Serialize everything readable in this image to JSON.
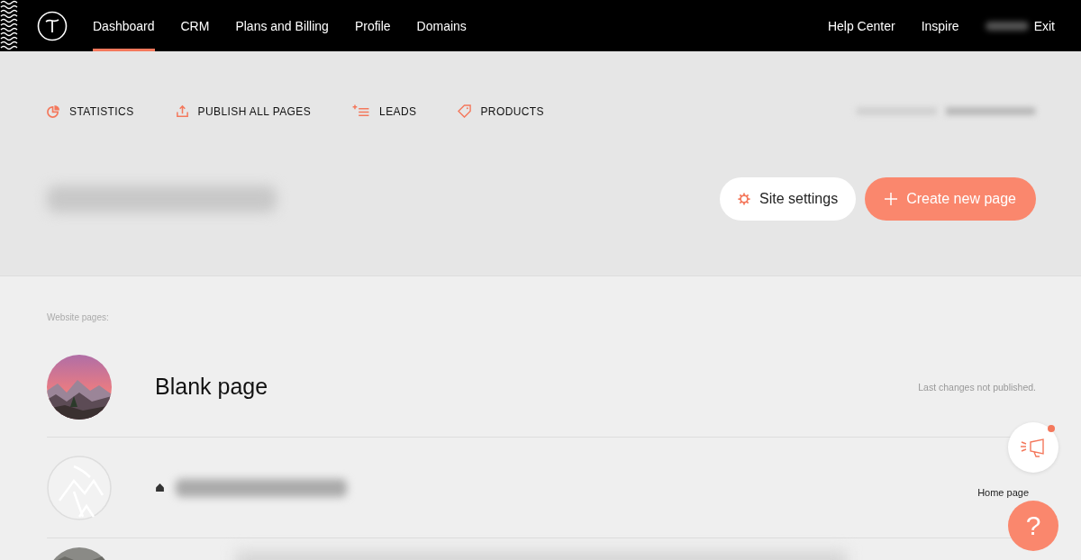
{
  "nav": {
    "items": [
      {
        "label": "Dashboard",
        "selected": true
      },
      {
        "label": "CRM",
        "selected": false
      },
      {
        "label": "Plans and Billing",
        "selected": false
      },
      {
        "label": "Profile",
        "selected": false
      },
      {
        "label": "Domains",
        "selected": false
      }
    ],
    "right": [
      "Help Center",
      "Inspire"
    ],
    "exit": "Exit"
  },
  "toolbar": {
    "actions": [
      {
        "label": "STATISTICS",
        "kind": "statistics"
      },
      {
        "label": "PUBLISH ALL PAGES",
        "kind": "publish"
      },
      {
        "label": "LEADS",
        "kind": "leads"
      },
      {
        "label": "PRODUCTS",
        "kind": "products"
      }
    ]
  },
  "site": {
    "settings_button": "Site settings",
    "create_button": "Create new page"
  },
  "pages": {
    "heading": "Website pages:",
    "rows": [
      {
        "title": "Blank page",
        "status": "Last changes not published.",
        "kind": "picture"
      },
      {
        "status": "Home page",
        "kind": "logo"
      }
    ]
  },
  "help": {
    "label": "?",
    "notification": true
  }
}
